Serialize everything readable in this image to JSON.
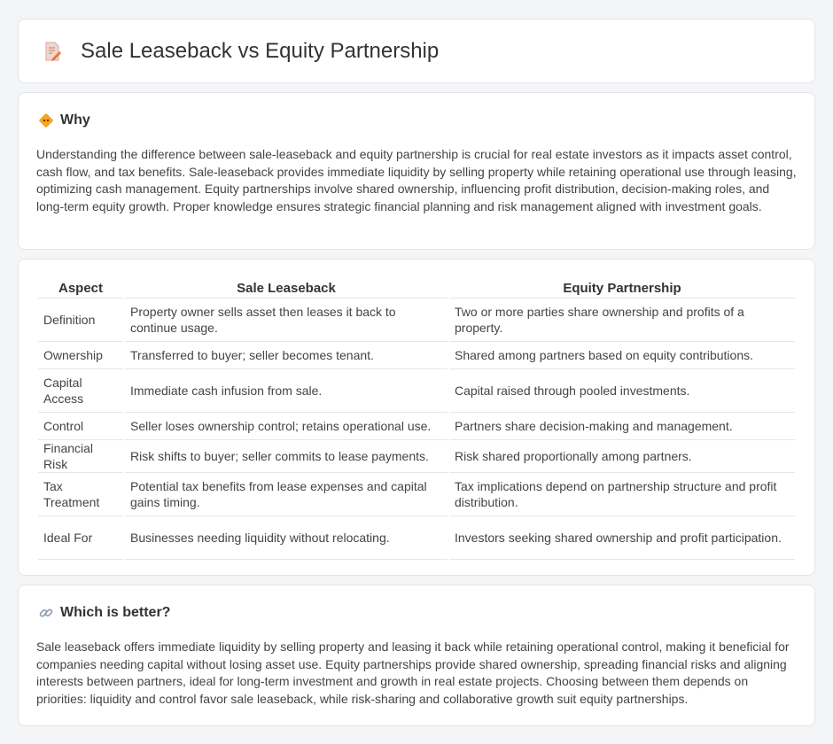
{
  "header": {
    "title": "Sale Leaseback vs Equity Partnership",
    "icon": "document-edit-icon"
  },
  "why": {
    "heading": "Why",
    "icon": "diamond-sign-icon",
    "text": "Understanding the difference between sale-leaseback and equity partnership is crucial for real estate investors as it impacts asset control, cash flow, and tax benefits. Sale-leaseback provides immediate liquidity by selling property while retaining operational use through leasing, optimizing cash management. Equity partnerships involve shared ownership, influencing profit distribution, decision-making roles, and long-term equity growth. Proper knowledge ensures strategic financial planning and risk management aligned with investment goals."
  },
  "table": {
    "headers": [
      "Aspect",
      "Sale Leaseback",
      "Equity Partnership"
    ],
    "rows": [
      [
        "Definition",
        "Property owner sells asset then leases it back to continue usage.",
        "Two or more parties share ownership and profits of a property."
      ],
      [
        "Ownership",
        "Transferred to buyer; seller becomes tenant.",
        "Shared among partners based on equity contributions."
      ],
      [
        "Capital Access",
        "Immediate cash infusion from sale.",
        "Capital raised through pooled investments."
      ],
      [
        "Control",
        "Seller loses ownership control; retains operational use.",
        "Partners share decision-making and management."
      ],
      [
        "Financial Risk",
        "Risk shifts to buyer; seller commits to lease payments.",
        "Risk shared proportionally among partners."
      ],
      [
        "Tax Treatment",
        "Potential tax benefits from lease expenses and capital gains timing.",
        "Tax implications depend on partnership structure and profit distribution."
      ],
      [
        "Ideal For",
        "Businesses needing liquidity without relocating.",
        "Investors seeking shared ownership and profit participation."
      ]
    ]
  },
  "better": {
    "heading": "Which is better?",
    "icon": "link-icon",
    "text": "Sale leaseback offers immediate liquidity by selling property and leasing it back while retaining operational control, making it beneficial for companies needing capital without losing asset use. Equity partnerships provide shared ownership, spreading financial risks and aligning interests between partners, ideal for long-term investment and growth in real estate projects. Choosing between them depends on priorities: liquidity and control favor sale leaseback, while risk-sharing and collaborative growth suit equity partnerships."
  }
}
